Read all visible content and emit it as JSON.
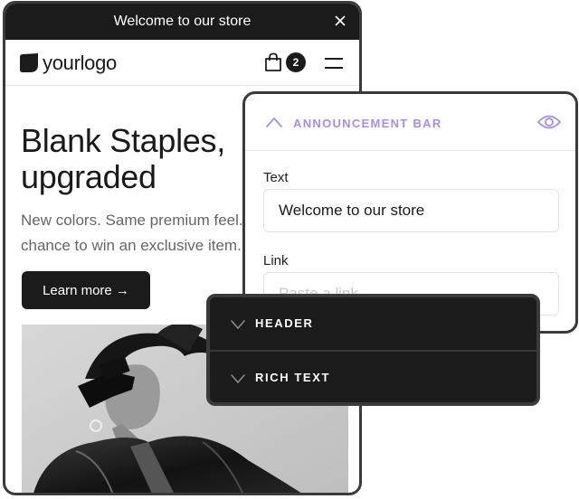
{
  "store": {
    "announcement": "Welcome to our store",
    "logo_text": "yourlogo",
    "cart_count": "2",
    "hero": {
      "title": "Blank Staples,\nupgraded",
      "subtitle_line1": "New colors. Same premium feel. Plus a",
      "subtitle_line2": "chance to win an exclusive item.",
      "cta_label": "Learn more →"
    },
    "icons": {
      "close": "close-icon",
      "logo": "logo-shield-icon",
      "cart": "shopping-bag-icon",
      "menu": "hamburger-menu-icon"
    }
  },
  "editor": {
    "section_title": "ANNOUNCEMENT BAR",
    "accent_color": "#a590e6",
    "text_field": {
      "label": "Text",
      "value": "Welcome to our store"
    },
    "link_field": {
      "label": "Link",
      "placeholder": "Paste a link"
    }
  },
  "sections": {
    "items": [
      {
        "label": "HEADER"
      },
      {
        "label": "RICH TEXT"
      }
    ]
  }
}
